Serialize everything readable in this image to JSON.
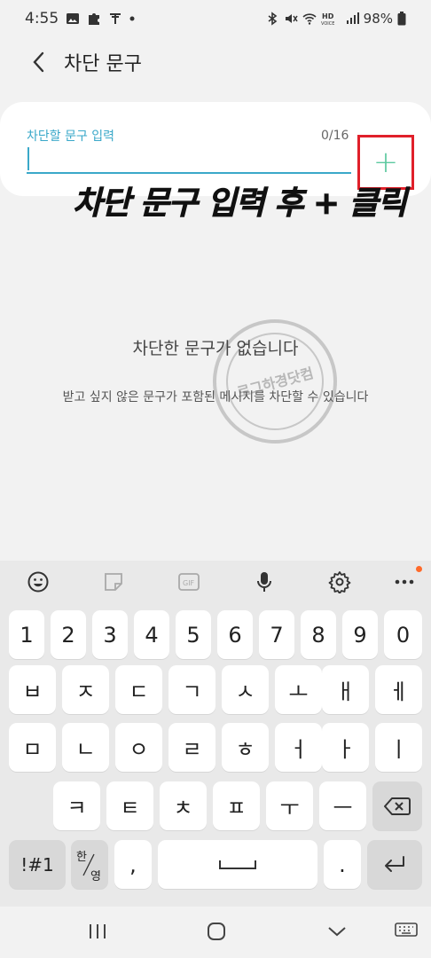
{
  "status": {
    "time": "4:55",
    "left_icons": [
      "image-icon",
      "puzzle-icon",
      "t-icon",
      "dot-icon"
    ],
    "right_icons": [
      "bluetooth-icon",
      "mute-icon",
      "wifi-icon",
      "hd-voice-icon",
      "signal-icon"
    ],
    "battery": "98%"
  },
  "appbar": {
    "title": "차단 문구"
  },
  "input": {
    "label": "차단할 문구 입력",
    "counter": "0/16",
    "value": "",
    "add_label": "+"
  },
  "annotation": "차단 문구 입력 후 + 클릭",
  "empty": {
    "title": "차단한 문구가 없습니다",
    "description": "받고 싶지 않은 문구가 포함된 메시지를 차단할 수 있습니다"
  },
  "watermark": {
    "text": "로그하경닷컴"
  },
  "keyboard": {
    "toolbar": [
      "emoji-icon",
      "sticker-icon",
      "gif-icon",
      "mic-icon",
      "settings-icon",
      "more-icon"
    ],
    "row_numbers": [
      "1",
      "2",
      "3",
      "4",
      "5",
      "6",
      "7",
      "8",
      "9",
      "0"
    ],
    "row1": [
      "ㅂ",
      "ㅈ",
      "ㄷ",
      "ㄱ",
      "ㅅ",
      "ㅗ",
      "ㅐ",
      "ㅔ"
    ],
    "row2": [
      "ㅁ",
      "ㄴ",
      "ㅇ",
      "ㄹ",
      "ㅎ",
      "ㅓ",
      "ㅏ",
      "ㅣ"
    ],
    "row3": [
      "ㅋ",
      "ㅌ",
      "ㅊ",
      "ㅍ",
      "ㅜ",
      "ㅡ"
    ],
    "symbols": "!#1",
    "lang_top": "한",
    "lang_bottom": "영",
    "comma": ",",
    "period": "."
  },
  "navbar": [
    "recent-apps-icon",
    "home-icon",
    "back-icon",
    "keyboard-icon"
  ],
  "colors": {
    "accent": "#3aa8c9",
    "highlight": "#e0202a",
    "plus": "#5cc9a0"
  }
}
